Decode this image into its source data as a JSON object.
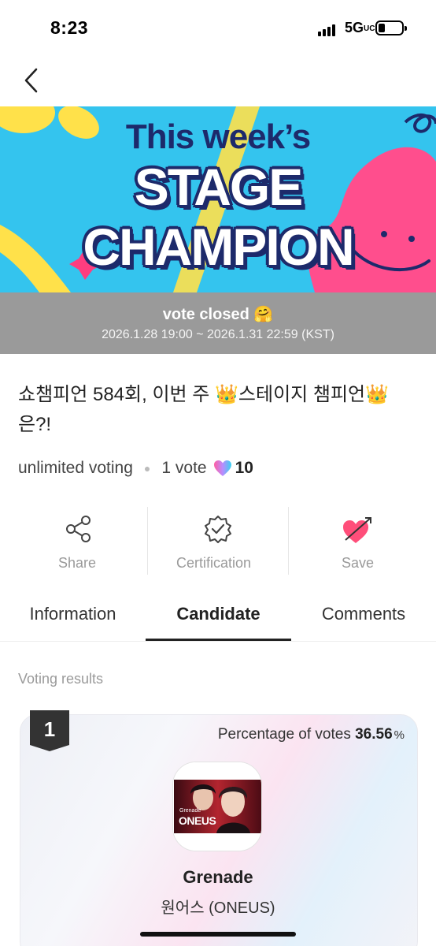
{
  "status_bar": {
    "time": "8:23",
    "network": "5G",
    "network_suffix": "UC"
  },
  "banner": {
    "line1": "This week’s",
    "line2": "STAGE CHAMPION",
    "colors": {
      "background": "#34c4ee",
      "title_navy": "#1d2a6b",
      "pink": "#ff3d7f",
      "yellow": "#ffe14a"
    }
  },
  "vote_bar": {
    "status": "vote closed 🤗",
    "date_range": "2026.1.28 19:00 ~ 2026.1.31 22:59 (KST)"
  },
  "title": "쇼챔피언 584회, 이번 주 👑스테이지 챔피언👑은?!",
  "meta": {
    "voting_type": "unlimited voting",
    "vote_unit": "1 vote",
    "heart_icon": "gradient-heart-icon",
    "heart_count": "10"
  },
  "actions": [
    {
      "label": "Share",
      "icon": "share-icon"
    },
    {
      "label": "Certification",
      "icon": "certification-badge-icon"
    },
    {
      "label": "Save",
      "icon": "heart-arrow-icon"
    }
  ],
  "tabs": [
    {
      "label": "Information",
      "active": false
    },
    {
      "label": "Candidate",
      "active": true
    },
    {
      "label": "Comments",
      "active": false
    }
  ],
  "section_label": "Voting results",
  "candidate": {
    "rank": "1",
    "pct_label": "Percentage of votes",
    "pct_value": "36.56",
    "pct_unit": "%",
    "thumb_caption_small": "Grenade",
    "thumb_caption": "ONEUS",
    "name": "Grenade",
    "artist": "원어스 (ONEUS)"
  }
}
